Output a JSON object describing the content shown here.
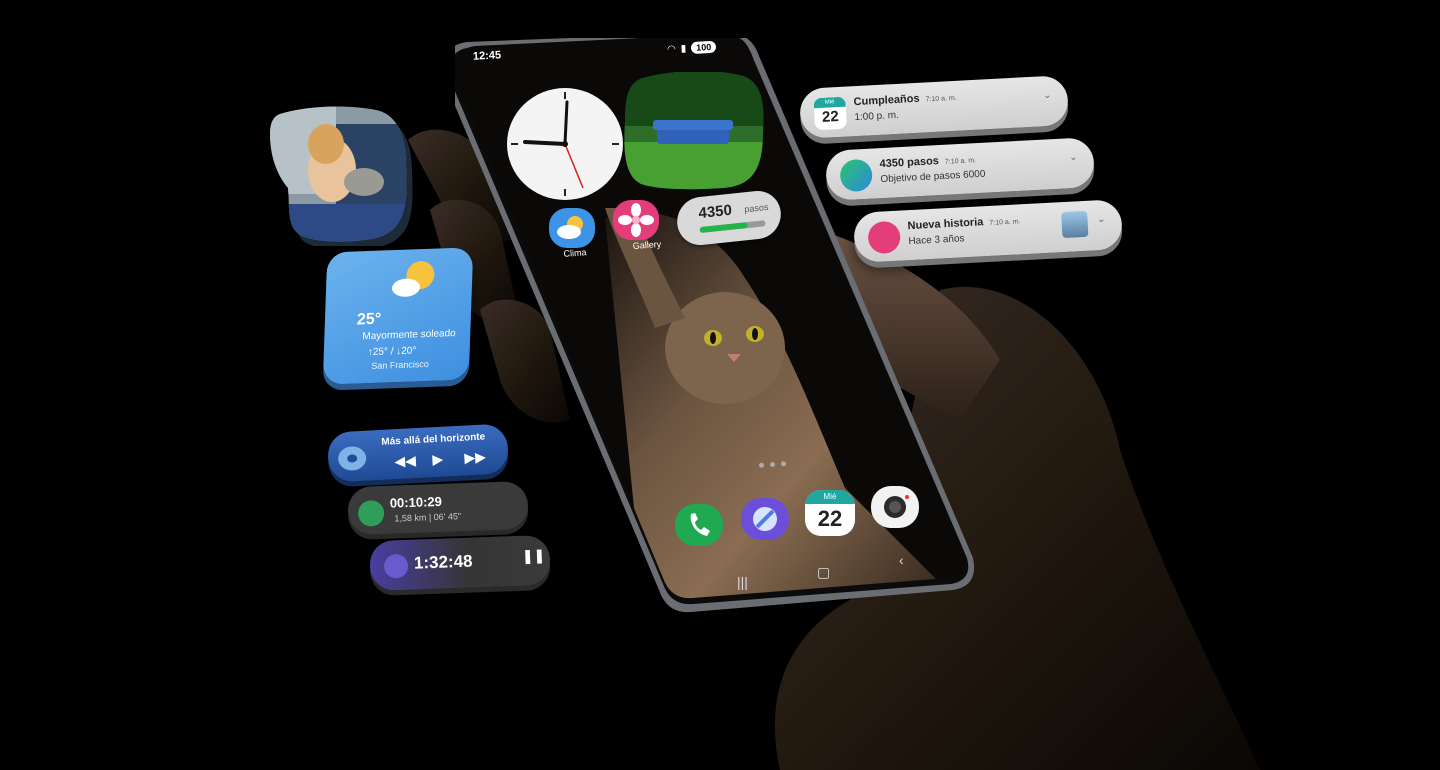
{
  "status_bar": {
    "time": "12:45",
    "battery": "100"
  },
  "home": {
    "steps_widget": {
      "count": "4350",
      "unit": "pasos",
      "progress": 0.72
    },
    "apps": [
      {
        "label": "Clima",
        "icon": "weather-icon"
      },
      {
        "label": "Gallery",
        "icon": "flower-icon"
      }
    ],
    "dock": [
      {
        "icon": "phone-icon"
      },
      {
        "icon": "internet-icon"
      },
      {
        "icon": "calendar-icon",
        "weekday": "Mié",
        "day": "22"
      },
      {
        "icon": "camera-icon"
      }
    ]
  },
  "widgets": {
    "weather": {
      "temp": "25°",
      "desc": "Mayormente soleado",
      "range": "↑25° / ↓20°",
      "city": "San Francisco"
    },
    "media": {
      "title": "Más allá del horizonte"
    },
    "run": {
      "time": "00:10:29",
      "details": "1,58 km | 06' 45\""
    },
    "timer": {
      "time": "1:32:48"
    }
  },
  "notifications": [
    {
      "title": "Cumpleaños",
      "time": "7:10 a. m.",
      "body": "1:00 p. m.",
      "weekday": "Mié",
      "day": "22",
      "icon": "calendar-icon"
    },
    {
      "title": "4350 pasos",
      "time": "7:10 a. m.",
      "body": "Objetivo de pasos 6000",
      "icon": "health-icon"
    },
    {
      "title": "Nueva historia",
      "time": "7:10 a. m.",
      "body": "Hace 3 años",
      "icon": "gallery-icon"
    }
  ],
  "colors": {
    "background": "#000000",
    "weather_blue": "#3d8fe0",
    "media_blue": "#1f4a94",
    "steps_green": "#25b34b",
    "calendar_teal": "#1fa7a0"
  }
}
